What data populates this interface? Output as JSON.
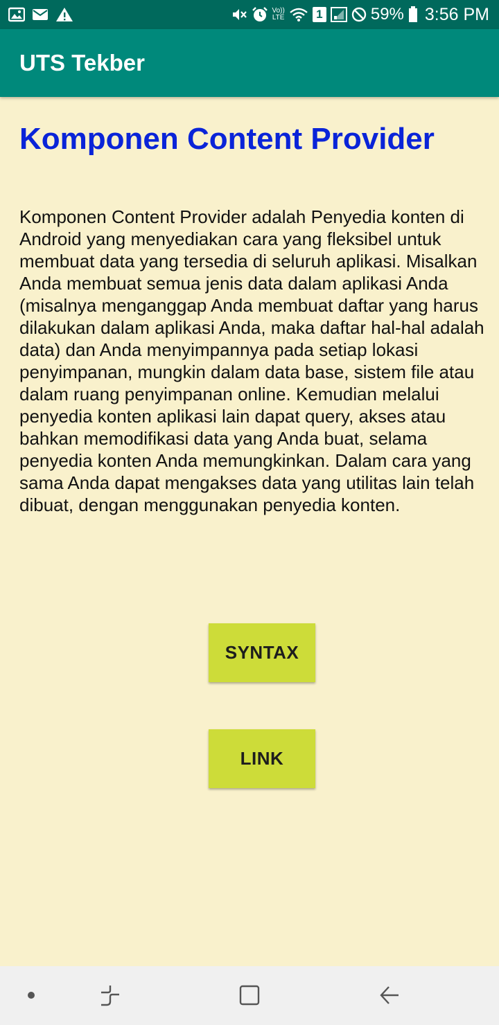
{
  "status_bar": {
    "left_icons": [
      "gallery-icon",
      "mail-icon",
      "warning-icon"
    ],
    "right_icons": [
      "mute-icon",
      "alarm-icon",
      "volte-icon",
      "wifi-icon",
      "sim-icon",
      "signal-icon",
      "do-not-disturb-icon",
      "battery-icon"
    ],
    "volte_line1": "Vo))",
    "volte_line2": "LTE",
    "sim_label": "1",
    "battery_percent": "59%",
    "time": "3:56 PM"
  },
  "app_bar": {
    "title": "UTS Tekber"
  },
  "main": {
    "heading": "Komponen Content Provider",
    "body": "Komponen Content Provider adalah Penyedia konten di Android yang menyediakan cara yang fleksibel untuk membuat data yang tersedia di seluruh aplikasi. Misalkan Anda membuat semua jenis data dalam aplikasi Anda (misalnya menganggap Anda membuat daftar yang harus dilakukan dalam aplikasi Anda, maka daftar hal-hal adalah data) dan Anda menyimpannya pada setiap lokasi penyimpanan, mungkin dalam data base, sistem file atau dalam ruang penyimpanan online. Kemudian melalui penyedia konten aplikasi lain dapat query, akses atau bahkan memodifikasi data yang Anda buat, selama penyedia konten Anda memungkinkan. Dalam cara yang sama Anda dapat mengakses data yang utilitas lain telah dibuat, dengan menggunakan penyedia konten.",
    "buttons": {
      "syntax": "SYNTAX",
      "link": "LINK"
    }
  },
  "nav_bar": {
    "icons": [
      "dot-icon",
      "recents-icon",
      "home-icon",
      "back-icon"
    ]
  },
  "colors": {
    "status_bar": "#00695c",
    "app_bar": "#00897b",
    "background": "#f9f1cc",
    "heading": "#0a24d8",
    "button": "#cddc39",
    "nav_bar": "#f0f0f0"
  }
}
